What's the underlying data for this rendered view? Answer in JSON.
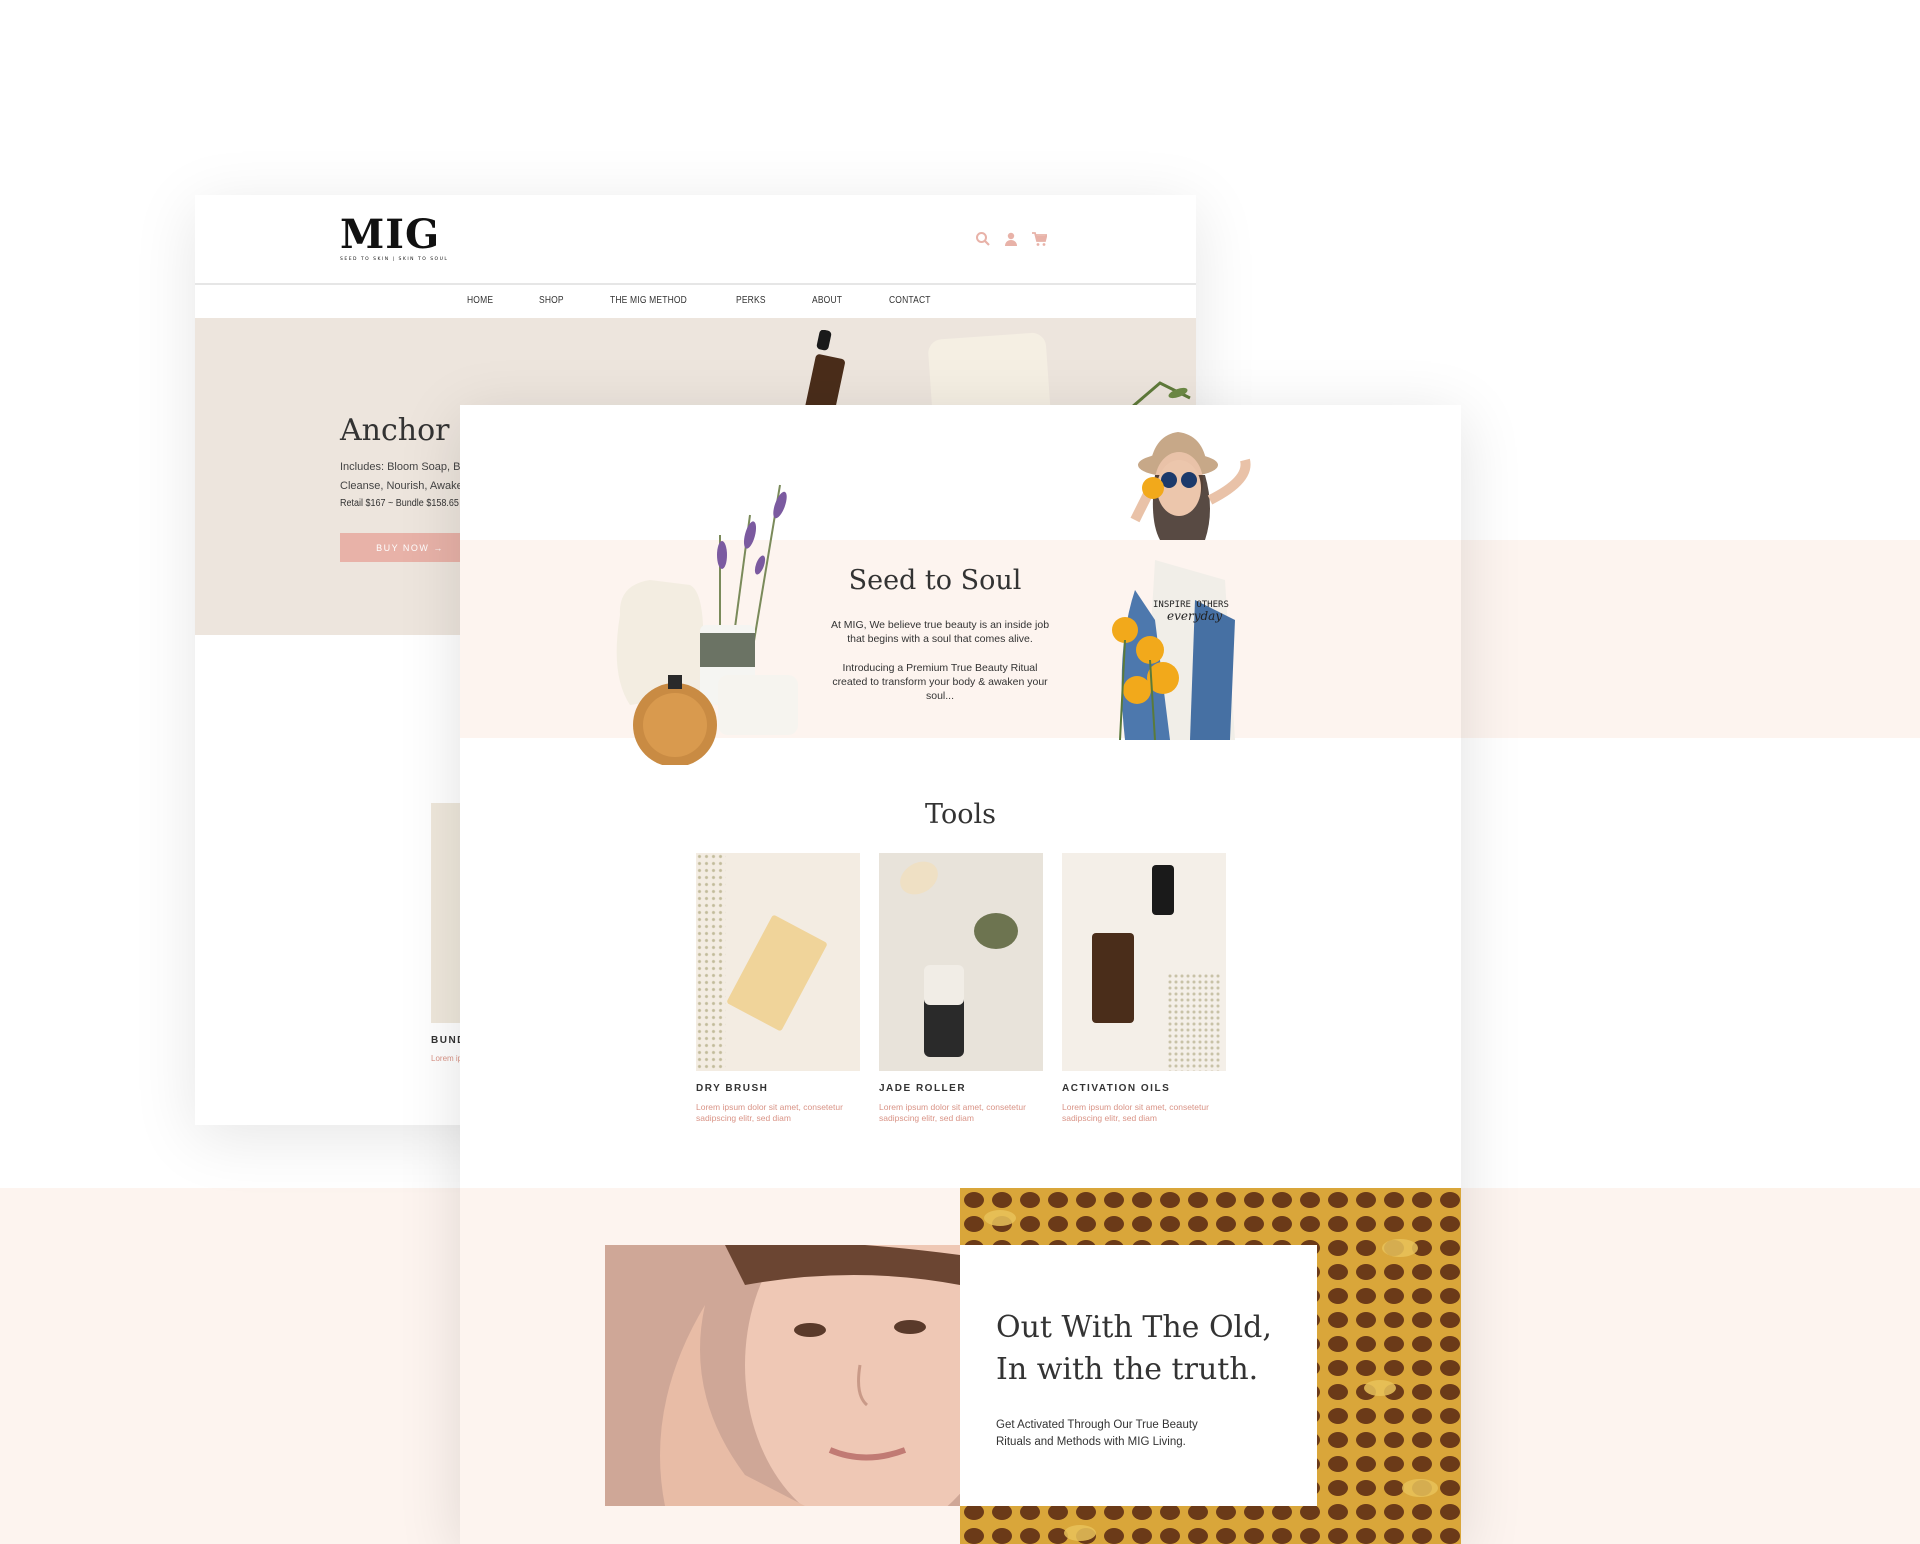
{
  "brand": {
    "logo": "MIG",
    "tagline": "SEED TO SKIN | SKIN TO SOUL"
  },
  "header_icons": [
    "search-icon",
    "user-icon",
    "cart-icon"
  ],
  "nav": [
    "HOME",
    "SHOP",
    "THE MIG METHOD",
    "PERKS",
    "ABOUT",
    "CONTACT"
  ],
  "hero": {
    "title": "Anchor Bundle",
    "includes_line1": "Includes: Bloom Soap, Bloom Butter,",
    "includes_line2": "Cleanse, Nourish, Awaken",
    "price": "Retail $167 ~  Bundle $158.65",
    "button": "BUY NOW →"
  },
  "back_product": {
    "title": "BUNDLE",
    "desc": "Lorem ipsum dolor sit amet, consetetur sadipscing elitr, sed diam"
  },
  "seed": {
    "title": "Seed to Soul",
    "p1": "At MIG, We believe true beauty is an inside job that begins with a soul that comes alive.",
    "p2": "Introducing a Premium True Beauty Ritual created to transform your body & awaken your soul..."
  },
  "shirt_text": {
    "line1": "INSPIRE OTHERS",
    "line2": "everyday"
  },
  "tools": {
    "title": "Tools",
    "items": [
      {
        "title": "DRY BRUSH",
        "desc": "Lorem ipsum dolor sit amet, consetetur sadipscing elitr, sed diam"
      },
      {
        "title": "JADE ROLLER",
        "desc": "Lorem ipsum dolor sit amet, consetetur sadipscing elitr, sed diam"
      },
      {
        "title": "ACTIVATION OILS",
        "desc": "Lorem ipsum dolor sit amet, consetetur sadipscing elitr, sed diam"
      }
    ]
  },
  "truth": {
    "title_line1": "Out With The Old,",
    "title_line2": "In with the truth.",
    "desc": "Get Activated Through Our True Beauty Rituals and Methods with MIG Living."
  },
  "colors": {
    "accent": "#e8b2a8",
    "band": "#fdf4ef",
    "hero_bg": "#ede5dd",
    "link_text": "#d99487"
  }
}
